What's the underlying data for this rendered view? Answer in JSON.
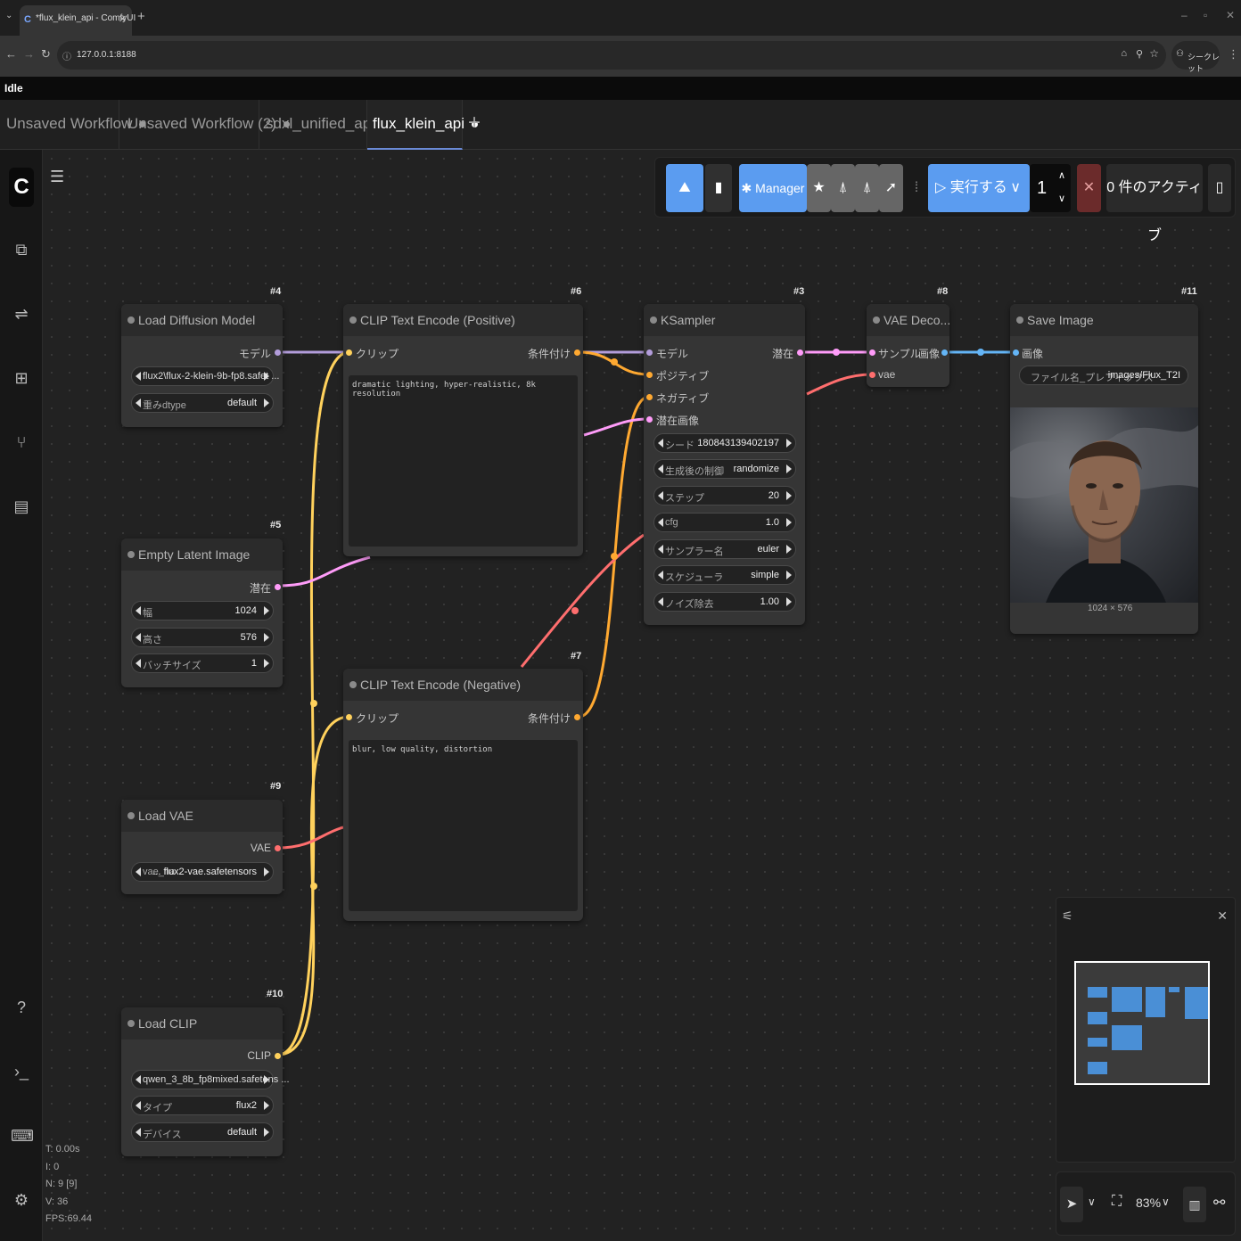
{
  "browser": {
    "tab_title": "*flux_klein_api - ComfyUI",
    "url": "127.0.0.1:8188",
    "incognito_label": "シークレット"
  },
  "status": "Idle",
  "workflow_tabs": [
    {
      "label": "Unsaved Workflow",
      "active": false
    },
    {
      "label": "Unsaved Workflow (2)",
      "active": false
    },
    {
      "label": "sdxl_unified_api",
      "active": false
    },
    {
      "label": "flux_klein_api",
      "active": true
    }
  ],
  "toolbar": {
    "manager_label": "Manager",
    "run_label": "実行する",
    "batch_count": "1",
    "active_label": "0 件のアクティブ"
  },
  "nodes": {
    "load_diffusion": {
      "id": "#4",
      "title": "Load Diffusion Model",
      "output": "モデル",
      "unet_value": "flux2\\flux-2-klein-9b-fp8.safet ...",
      "dtype_label": "重みdtype",
      "dtype_value": "default"
    },
    "empty_latent": {
      "id": "#5",
      "title": "Empty Latent Image",
      "output": "潜在",
      "width_label": "幅",
      "width_value": "1024",
      "height_label": "高さ",
      "height_value": "576",
      "batch_label": "バッチサイズ",
      "batch_value": "1"
    },
    "load_vae": {
      "id": "#9",
      "title": "Load VAE",
      "output": "VAE",
      "vae_label": "vae_na",
      "vae_value": "... flux2-vae.safetensors"
    },
    "load_clip": {
      "id": "#10",
      "title": "Load CLIP",
      "output": "CLIP",
      "clip_value": "qwen_3_8b_fp8mixed.safetens ...",
      "type_label": "タイプ",
      "type_value": "flux2",
      "device_label": "デバイス",
      "device_value": "default"
    },
    "clip_pos": {
      "id": "#6",
      "title": "CLIP Text Encode (Positive)",
      "input": "クリップ",
      "output": "条件付け",
      "text": "dramatic lighting, hyper-realistic, 8k resolution"
    },
    "clip_neg": {
      "id": "#7",
      "title": "CLIP Text Encode (Negative)",
      "input": "クリップ",
      "output": "条件付け",
      "text": "blur, low quality, distortion"
    },
    "ksampler": {
      "id": "#3",
      "title": "KSampler",
      "in_model": "モデル",
      "in_pos": "ポジティブ",
      "in_neg": "ネガティブ",
      "in_latent": "潜在画像",
      "output": "潜在",
      "widgets": [
        {
          "label": "シード",
          "value": "180843139402197"
        },
        {
          "label": "生成後の制御",
          "value": "randomize"
        },
        {
          "label": "ステップ",
          "value": "20"
        },
        {
          "label": "cfg",
          "value": "1.0"
        },
        {
          "label": "サンプラー名",
          "value": "euler"
        },
        {
          "label": "スケジューラ",
          "value": "simple"
        },
        {
          "label": "ノイズ除去",
          "value": "1.00"
        }
      ]
    },
    "vae_decode": {
      "id": "#8",
      "title": "VAE Deco...",
      "in_samples": "サンプル",
      "in_vae": "vae",
      "output": "画像"
    },
    "save_image": {
      "id": "#11",
      "title": "Save Image",
      "input": "画像",
      "prefix_label": "ファイル名_プレフィックス",
      "prefix_value": "images/Flux_T2I",
      "image_size": "1024 × 576"
    }
  },
  "bottom": {
    "zoom": "83%"
  },
  "stats": {
    "t": "T: 0.00s",
    "i": "I: 0",
    "n": "N: 9 [9]",
    "v": "V: 36",
    "fps": "FPS:69.44"
  },
  "colors": {
    "model": "#b39ddb",
    "clip": "#ffd15c",
    "conditioning": "#ffa931",
    "latent": "#ff9cf9",
    "vae": "#ff6e6e",
    "image": "#64b5f6",
    "accent": "#5b9cf0"
  }
}
